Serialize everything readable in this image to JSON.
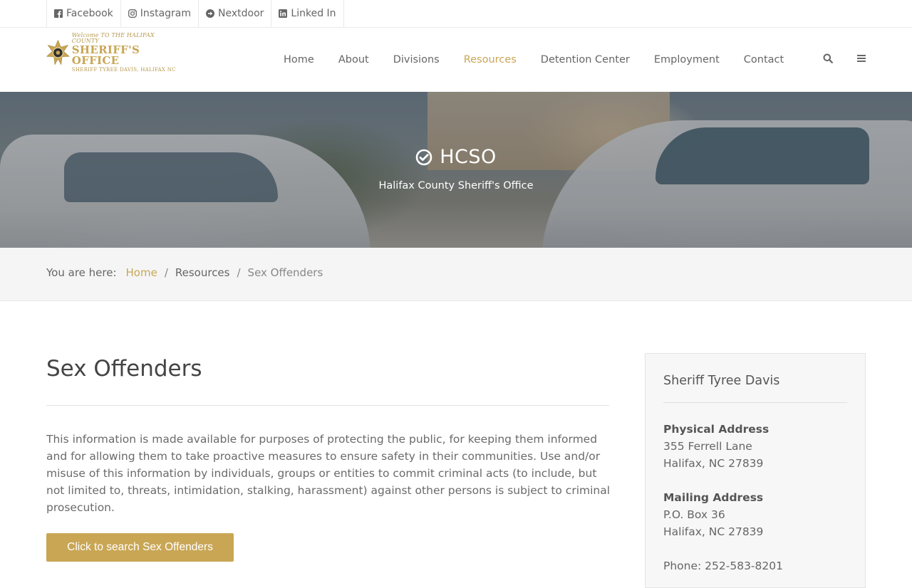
{
  "social": [
    {
      "label": "Facebook",
      "icon": "facebook-icon"
    },
    {
      "label": "Instagram",
      "icon": "instagram-icon"
    },
    {
      "label": "Nextdoor",
      "icon": "arrow-circle-right-icon"
    },
    {
      "label": "Linked In",
      "icon": "linkedin-icon"
    }
  ],
  "logo": {
    "line1": "Welcome TO THE HALIFAX COUNTY",
    "line2": "SHERIFF'S OFFICE",
    "line3": "SHERIFF TYREE DAVIS, HALIFAX NC"
  },
  "nav": {
    "items": [
      {
        "label": "Home"
      },
      {
        "label": "About"
      },
      {
        "label": "Divisions"
      },
      {
        "label": "Resources",
        "active": true
      },
      {
        "label": "Detention Center"
      },
      {
        "label": "Employment"
      },
      {
        "label": "Contact"
      }
    ]
  },
  "hero": {
    "title": "HCSO",
    "subtitle": "Halifax County Sheriff's Office"
  },
  "breadcrumb": {
    "prefix": "You are here:",
    "items": [
      "Home",
      "Resources",
      "Sex Offenders"
    ],
    "separator": "/"
  },
  "main": {
    "title": "Sex Offenders",
    "intro": "This information is made available for purposes of protecting the public, for keeping them informed and for allowing them to take proactive measures to ensure safety in their communities. Use and/or misuse of this information by individuals, groups or entities to commit criminal acts (to include, but not limited to, threats, intimidation, stalking, harassment) against other persons is subject to criminal prosecution.",
    "cta_label": "Click to search Sex Offenders"
  },
  "sidebar": {
    "title": "Sheriff Tyree Davis",
    "physical_heading": "Physical Address",
    "physical_line1": "355 Ferrell Lane",
    "physical_line2": "Halifax, NC 27839",
    "mailing_heading": "Mailing Address",
    "mailing_line1": "P.O. Box 36",
    "mailing_line2": "Halifax, NC 27839",
    "phone": "Phone: 252-583-8201"
  },
  "colors": {
    "accent": "#c9a654",
    "text": "#666666",
    "breadcrumb_bg": "#f5f5f5"
  }
}
